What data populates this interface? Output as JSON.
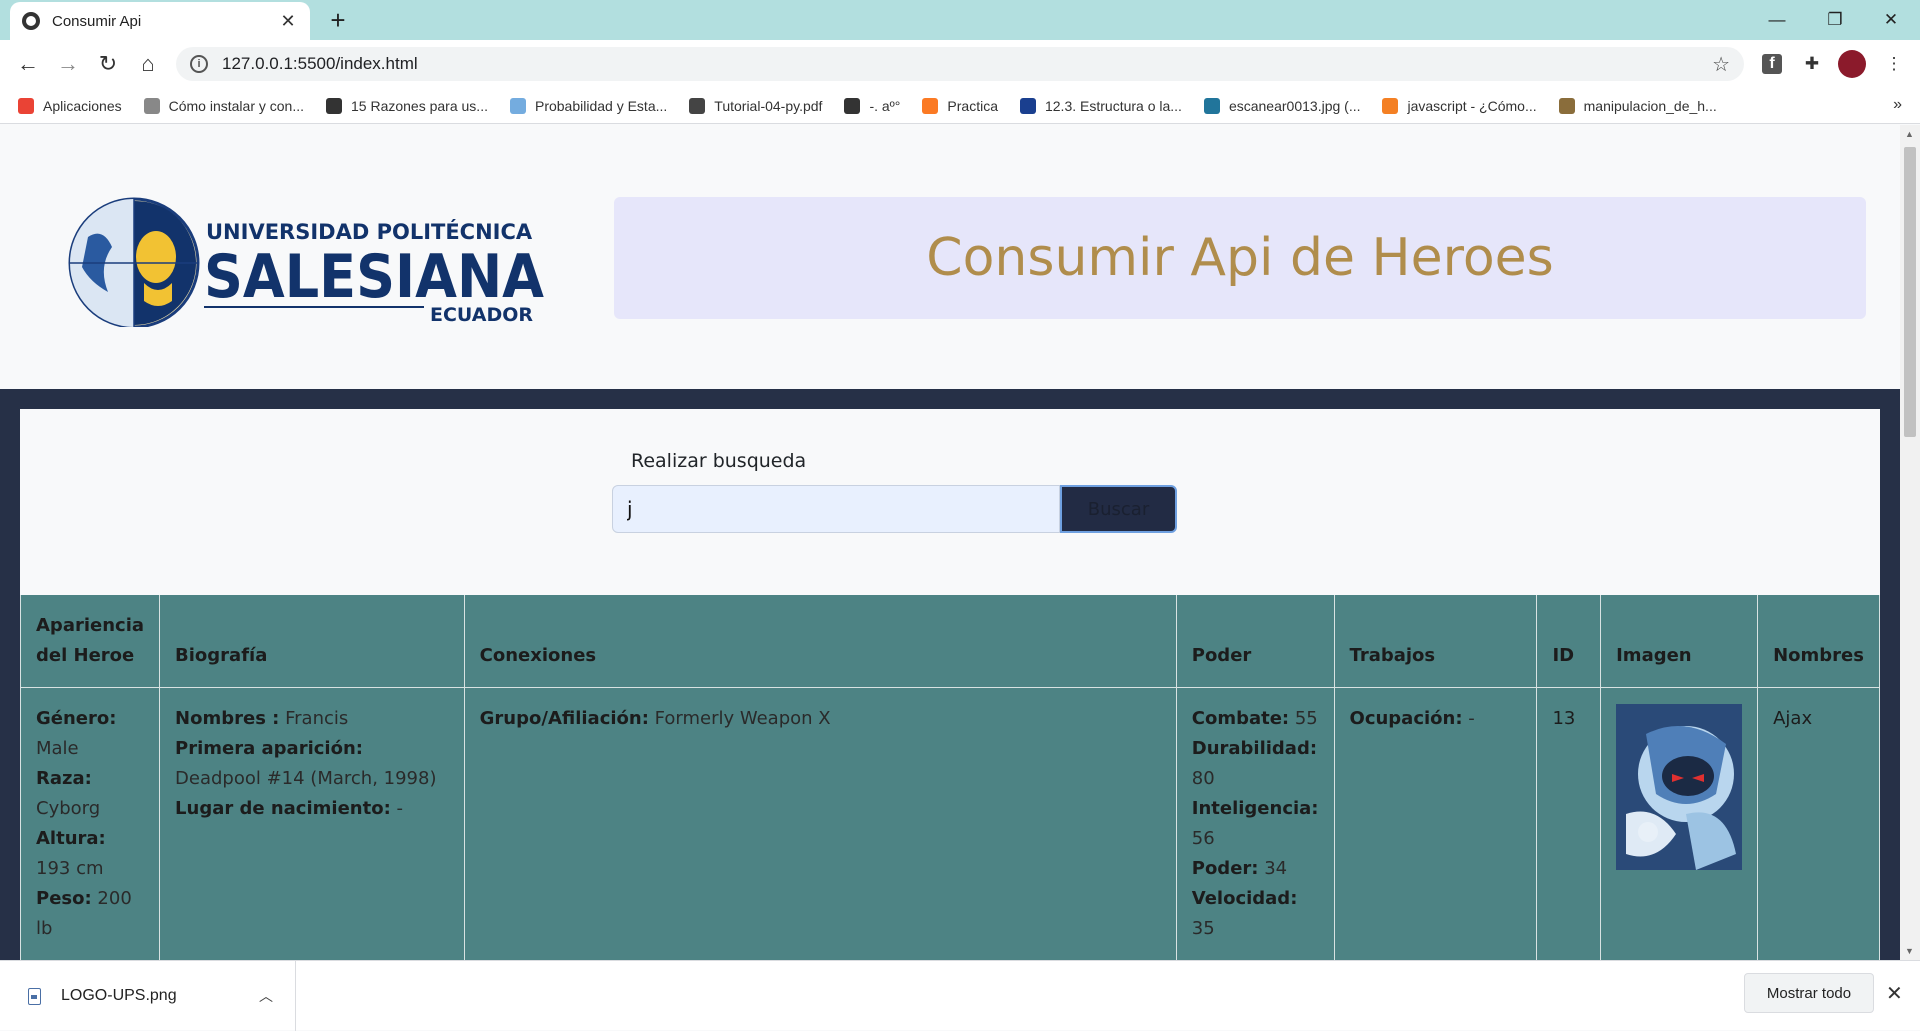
{
  "browser": {
    "tab_title": "Consumir Api",
    "tab_close": "✕",
    "new_tab": "+",
    "url": "127.0.0.1:5500/index.html",
    "window_controls": {
      "minimize": "—",
      "restore": "❐",
      "close": "✕"
    },
    "bookmarks": [
      {
        "label": "Aplicaciones",
        "icon": "apps-grid-icon",
        "color": "#ea4335"
      },
      {
        "label": "Cómo instalar y con...",
        "icon": "search-icon",
        "color": "#888888"
      },
      {
        "label": "15 Razones para us...",
        "icon": "globe-icon",
        "color": "#333333"
      },
      {
        "label": "Probabilidad y Esta...",
        "icon": "flag-icon",
        "color": "#74acdf"
      },
      {
        "label": "Tutorial-04-py.pdf",
        "icon": "pdf-icon",
        "color": "#444444"
      },
      {
        "label": "-. aº°",
        "icon": "globe-icon",
        "color": "#333333"
      },
      {
        "label": "Practica",
        "icon": "xampp-icon",
        "color": "#fb7a24"
      },
      {
        "label": "12.3. Estructura o la...",
        "icon": "diamond-icon",
        "color": "#1a3f8f"
      },
      {
        "label": "escanear0013.jpg (...",
        "icon": "wordpress-icon",
        "color": "#21759b"
      },
      {
        "label": "javascript - ¿Cómo...",
        "icon": "stackoverflow-icon",
        "color": "#f48024"
      },
      {
        "label": "manipulacion_de_h...",
        "icon": "image-icon",
        "color": "#8a6d3b"
      }
    ],
    "bookmarks_more": "»"
  },
  "page": {
    "logo": {
      "line1": "UNIVERSIDAD POLITÉCNICA",
      "line2": "SALESIANA",
      "line3": "ECUADOR"
    },
    "banner_title": "Consumir Api de Heroes",
    "search": {
      "label": "Realizar busqueda",
      "value": "j",
      "button": "Buscar"
    },
    "table": {
      "headers": [
        "Apariencia del Heroe",
        "Biografía",
        "Conexiones",
        "Poder",
        "Trabajos",
        "ID",
        "Imagen",
        "Nombres"
      ],
      "row": {
        "apariencia": [
          {
            "k": "Género:",
            "v": "Male"
          },
          {
            "k": "Raza:",
            "v": "Cyborg"
          },
          {
            "k": "Altura:",
            "v": "193 cm"
          },
          {
            "k": "Peso:",
            "v": "200 lb"
          }
        ],
        "biografia": [
          {
            "k": "Nombres :",
            "v": "Francis"
          },
          {
            "k": "Primera aparición:",
            "v": "Deadpool #14 (March, 1998)"
          },
          {
            "k": "Lugar de nacimiento:",
            "v": "-"
          }
        ],
        "conexiones": [
          {
            "k": "Grupo/Afiliación:",
            "v": "Formerly Weapon X"
          }
        ],
        "poder": [
          {
            "k": "Combate:",
            "v": "55"
          },
          {
            "k": "Durabilidad:",
            "v": "80"
          },
          {
            "k": "Inteligencia:",
            "v": "56"
          },
          {
            "k": "Poder:",
            "v": "34"
          },
          {
            "k": "Velocidad:",
            "v": "35"
          }
        ],
        "trabajos": [
          {
            "k": "Ocupación:",
            "v": "-"
          }
        ],
        "id": "13",
        "nombre": "Ajax"
      }
    }
  },
  "downloads": {
    "file": "LOGO-UPS.png",
    "show_all": "Mostrar todo",
    "close": "✕"
  }
}
